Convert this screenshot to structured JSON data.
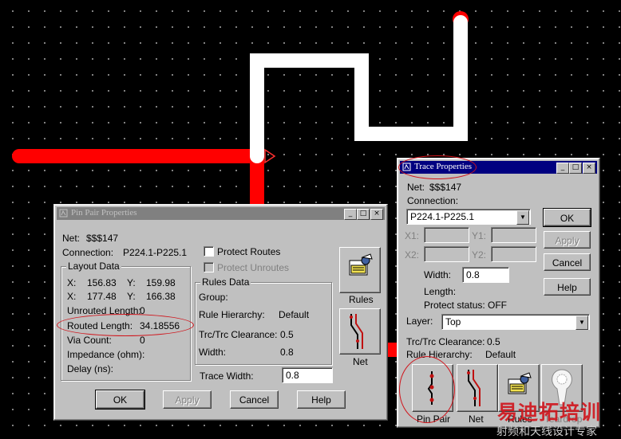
{
  "pin_pair_dialog": {
    "title": "Pin Pair Properties",
    "net_label": "Net:",
    "net_value": "$$$147",
    "connection_label": "Connection:",
    "connection_value": "P224.1-P225.1",
    "layout_data_title": "Layout Data",
    "x_label": "X:",
    "y_label": "Y:",
    "x1": "156.83",
    "y1": "159.98",
    "x2": "177.48",
    "y2": "166.38",
    "unrouted_label": "Unrouted Length:",
    "unrouted_value": "0",
    "routed_label": "Routed Length:",
    "routed_value": "34.18556",
    "via_label": "Via Count:",
    "via_value": "0",
    "impedance_label": "Impedance (ohm):",
    "delay_label": "Delay (ns):",
    "protect_routes": "Protect Routes",
    "protect_unroutes": "Protect Unroutes",
    "rules_data_title": "Rules Data",
    "group_label": "Group:",
    "rule_hierarchy_label": "Rule Hierarchy:",
    "rule_hierarchy_value": "Default",
    "clearance_label": "Trc/Trc Clearance:",
    "clearance_value": "0.5",
    "width_label": "Width:",
    "width_value": "0.8",
    "trace_width_label": "Trace Width:",
    "trace_width_value": "0.8",
    "rules_btn_label": "Rules",
    "net_btn_label": "Net",
    "ok": "OK",
    "apply": "Apply",
    "cancel": "Cancel",
    "help": "Help"
  },
  "trace_dialog": {
    "title": "Trace Properties",
    "net_label": "Net:",
    "net_value": "$$$147",
    "connection_label": "Connection:",
    "connection_value": "P224.1-P225.1",
    "x1_label": "X1:",
    "y1_label": "Y1:",
    "x2_label": "X2:",
    "y2_label": "Y2:",
    "width_label": "Width:",
    "width_value": "0.8",
    "length_label": "Length:",
    "protect_status_label": "Protect status:",
    "protect_status_value": "OFF",
    "layer_label": "Layer:",
    "layer_value": "Top",
    "clearance_label": "Trc/Trc Clearance:",
    "clearance_value": "0.5",
    "rule_hierarchy_label": "Rule Hierarchy:",
    "rule_hierarchy_value": "Default",
    "ok": "OK",
    "apply": "Apply",
    "cancel": "Cancel",
    "help": "Help",
    "pin_pair_label": "Pin Pair",
    "net_btn_label": "Net",
    "rules_btn_label": "Rules",
    "teardrop_label": "Teardrop"
  },
  "watermark": {
    "line1": "易迪拓培训",
    "line2": "射频和天线设计专家"
  },
  "colors": {
    "route_red": "#ff0000",
    "route_white": "#ffffff",
    "dialog_face": "#c0c0c0",
    "title_active": "#000080",
    "title_inactive": "#808080",
    "highlight_circle": "#d0141b"
  }
}
